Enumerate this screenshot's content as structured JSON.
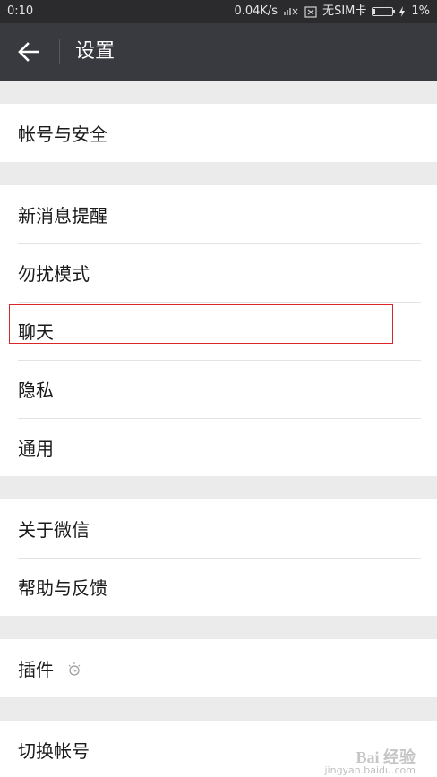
{
  "status_bar": {
    "time": "0:10",
    "network_speed": "0.04K/s",
    "sim_status": "无SIM卡",
    "battery_percent": "1%",
    "battery_level": 0.01,
    "icons": [
      "signal-icon",
      "no-sim-icon",
      "battery-icon",
      "charging-icon"
    ]
  },
  "app_bar": {
    "title": "设置",
    "back_icon": "arrow-left-icon"
  },
  "menu": {
    "account_security": "帐号与安全",
    "new_message_alerts": "新消息提醒",
    "do_not_disturb": "勿扰模式",
    "chat": "聊天",
    "privacy": "隐私",
    "general": "通用",
    "about_wechat": "关于微信",
    "help_feedback": "帮助与反馈",
    "plugins": "插件",
    "switch_account": "切换帐号"
  },
  "highlight": {
    "target": "chat",
    "color": "#d9262a"
  },
  "colors": {
    "status_bar_bg": "#2b2b2d",
    "app_bar_bg": "#393a3f",
    "page_bg": "#ebebeb",
    "item_bg": "#ffffff",
    "text": "#1a1a1a"
  },
  "watermark": {
    "text": "Bai 经验",
    "sub": "jingyan.baidu.com"
  }
}
